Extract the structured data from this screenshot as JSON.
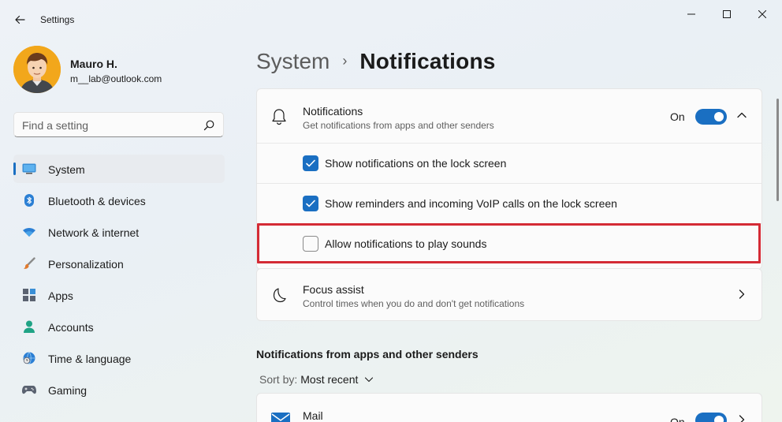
{
  "window": {
    "app_title": "Settings",
    "accent_color": "#1a6fc2",
    "highlight_color": "#d42b35"
  },
  "profile": {
    "name": "Mauro H.",
    "email": "m__lab@outlook.com"
  },
  "search": {
    "placeholder": "Find a setting"
  },
  "sidebar": {
    "items": [
      {
        "label": "System",
        "icon": "monitor-icon",
        "active": true
      },
      {
        "label": "Bluetooth & devices",
        "icon": "bluetooth-icon"
      },
      {
        "label": "Network & internet",
        "icon": "wifi-icon"
      },
      {
        "label": "Personalization",
        "icon": "brush-icon"
      },
      {
        "label": "Apps",
        "icon": "apps-icon"
      },
      {
        "label": "Accounts",
        "icon": "person-icon"
      },
      {
        "label": "Time & language",
        "icon": "clock-globe-icon"
      },
      {
        "label": "Gaming",
        "icon": "gamepad-icon"
      }
    ]
  },
  "breadcrumb": {
    "parent": "System",
    "separator": "›",
    "current": "Notifications"
  },
  "notifications_card": {
    "title": "Notifications",
    "description": "Get notifications from apps and other senders",
    "toggle_state": "On",
    "options": [
      {
        "label": "Show notifications on the lock screen",
        "checked": true
      },
      {
        "label": "Show reminders and incoming VoIP calls on the lock screen",
        "checked": true
      },
      {
        "label": "Allow notifications to play sounds",
        "checked": false
      }
    ]
  },
  "focus_assist": {
    "title": "Focus assist",
    "description": "Control times when you do and don't get notifications"
  },
  "apps_section": {
    "title": "Notifications from apps and other senders",
    "sort_label": "Sort by:",
    "sort_value": "Most recent",
    "apps": [
      {
        "name": "Mail",
        "toggle_state": "On"
      }
    ]
  }
}
